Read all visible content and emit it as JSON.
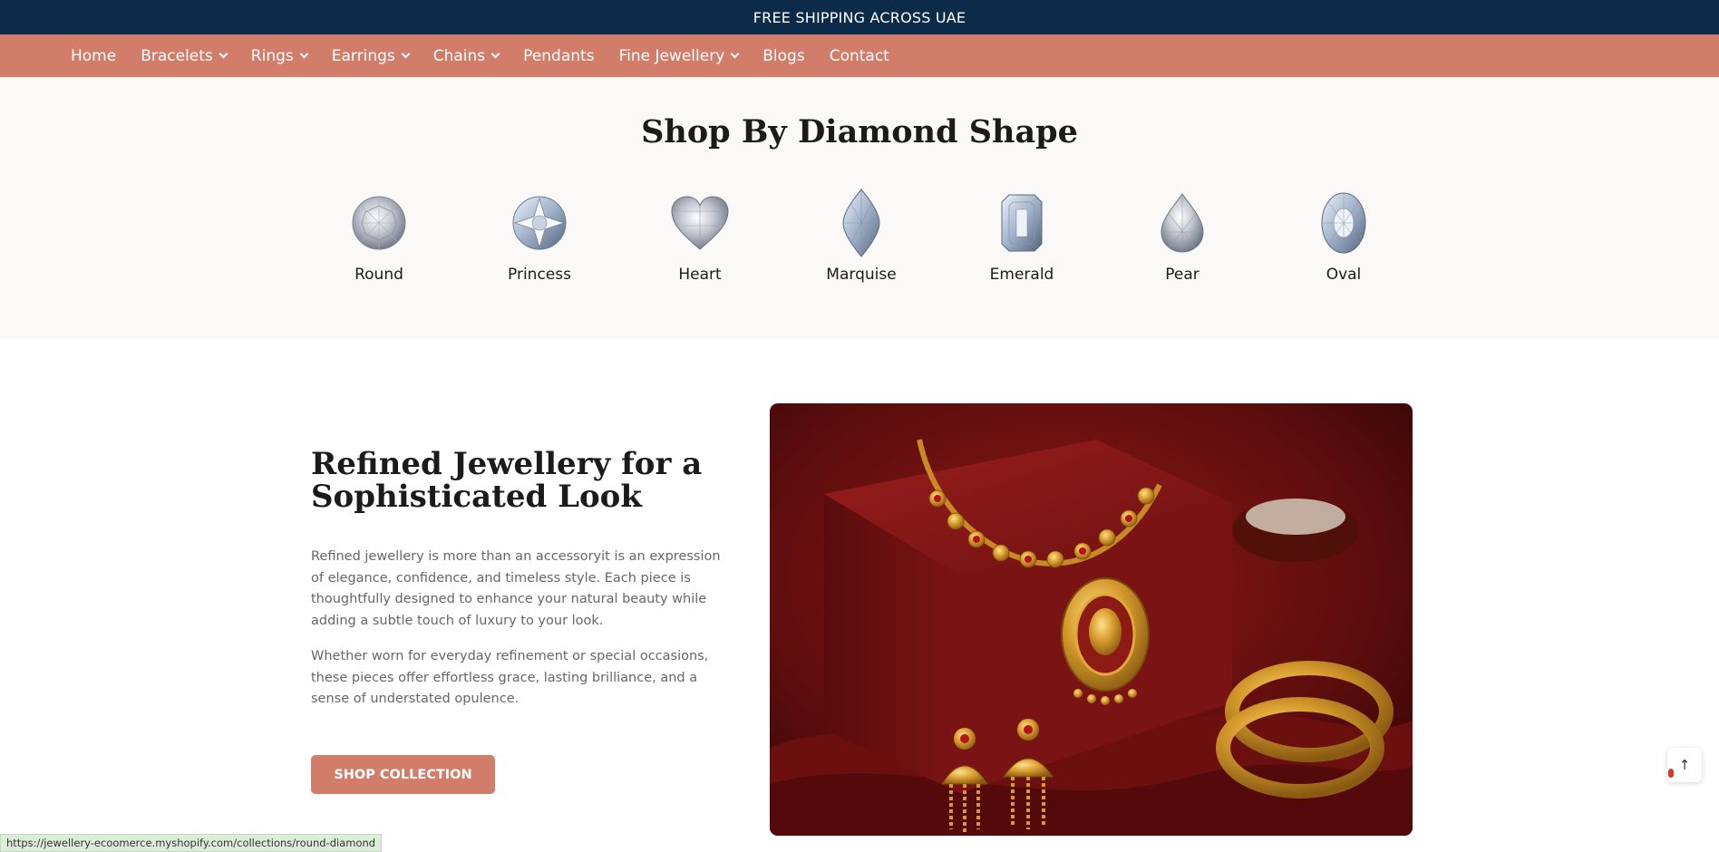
{
  "announcement": {
    "text": "FREE SHIPPING ACROSS UAE"
  },
  "nav": {
    "items": [
      {
        "label": "Home",
        "dropdown": false
      },
      {
        "label": "Bracelets",
        "dropdown": true
      },
      {
        "label": "Rings",
        "dropdown": true
      },
      {
        "label": "Earrings",
        "dropdown": true
      },
      {
        "label": "Chains",
        "dropdown": true
      },
      {
        "label": "Pendants",
        "dropdown": false
      },
      {
        "label": "Fine Jewellery",
        "dropdown": true
      },
      {
        "label": "Blogs",
        "dropdown": false
      },
      {
        "label": "Contact",
        "dropdown": false
      }
    ]
  },
  "shapes": {
    "title": "Shop By Diamond Shape",
    "items": [
      {
        "label": "Round",
        "icon": "round-diamond-icon"
      },
      {
        "label": "Princess",
        "icon": "princess-diamond-icon"
      },
      {
        "label": "Heart",
        "icon": "heart-diamond-icon"
      },
      {
        "label": "Marquise",
        "icon": "marquise-diamond-icon"
      },
      {
        "label": "Emerald",
        "icon": "emerald-diamond-icon"
      },
      {
        "label": "Pear",
        "icon": "pear-diamond-icon"
      },
      {
        "label": "Oval",
        "icon": "oval-diamond-icon"
      }
    ]
  },
  "feature": {
    "title": "Refined Jewellery for a Sophisticated Look",
    "paragraph1": "Refined jewellery is more than an accessoryit is an expression of elegance, confidence, and timeless style. Each piece is thoughtfully designed to enhance your natural beauty while adding a subtle touch of luxury to your look.",
    "paragraph2": "Whether worn for everyday refinement or special occasions, these pieces offer effortless grace, lasting brilliance, and a sense of understated opulence.",
    "button_label": "SHOP COLLECTION"
  },
  "status_bar": {
    "url": "https://jewellery-ecoomerce.myshopify.com/collections/round-diamond"
  },
  "back_to_top": {
    "icon": "arrow-up-icon",
    "glyph": "↑"
  },
  "colors": {
    "announcement_bg": "#0c2b48",
    "nav_bg": "#d27d69",
    "button_bg": "#d27d69",
    "section_bg": "#faf9f7"
  }
}
